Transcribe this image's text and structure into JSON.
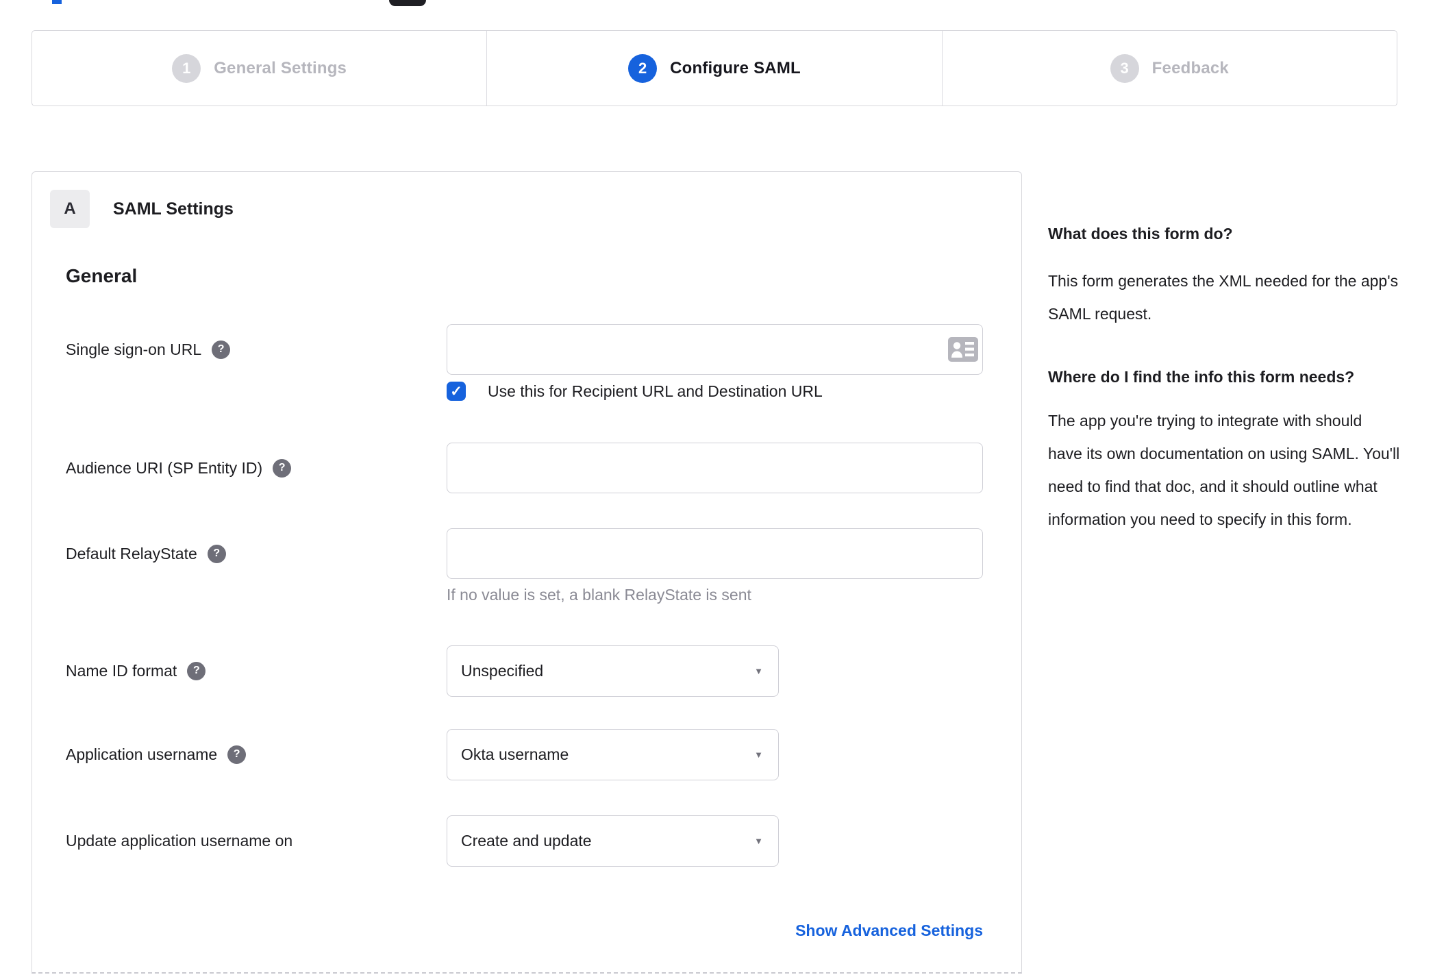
{
  "theme": {
    "accent_blue": "#1662dd",
    "text_dark": "#1d1d21",
    "step_inactive_gray": "#b6b6bd",
    "border_gray": "#d7d7dc",
    "help_icon_gray": "#6e6e78",
    "hint_gray": "#8a8a94"
  },
  "icons": {
    "help_glyph": "?",
    "caret_glyph": "▼",
    "check_glyph": "✓",
    "sso_input_icon": "contact-card-icon"
  },
  "stepper": {
    "steps": [
      {
        "number": "1",
        "label": "General Settings",
        "state": "inactive"
      },
      {
        "number": "2",
        "label": "Configure SAML",
        "state": "active"
      },
      {
        "number": "3",
        "label": "Feedback",
        "state": "inactive"
      }
    ]
  },
  "panel": {
    "section_badge": "A",
    "section_title": "SAML Settings",
    "group_heading": "General",
    "fields": {
      "sso_url": {
        "label": "Single sign-on URL",
        "value": "",
        "checkbox_label": "Use this for Recipient URL and Destination URL",
        "checkbox_checked": true
      },
      "audience_uri": {
        "label": "Audience URI (SP Entity ID)",
        "value": ""
      },
      "default_relaystate": {
        "label": "Default RelayState",
        "value": "",
        "hint": "If no value is set, a blank RelayState is sent"
      },
      "name_id_format": {
        "label": "Name ID format",
        "value": "Unspecified"
      },
      "app_username": {
        "label": "Application username",
        "value": "Okta username"
      },
      "update_app_username": {
        "label": "Update application username on",
        "value": "Create and update"
      }
    },
    "advanced_link": "Show Advanced Settings"
  },
  "sidebar": {
    "sections": [
      {
        "heading": "What does this form do?",
        "body": "This form generates the XML needed for the app's SAML request."
      },
      {
        "heading": "Where do I find the info this form needs?",
        "body": "The app you're trying to integrate with should have its own documentation on using SAML. You'll need to find that doc, and it should outline what information you need to specify in this form."
      }
    ]
  }
}
